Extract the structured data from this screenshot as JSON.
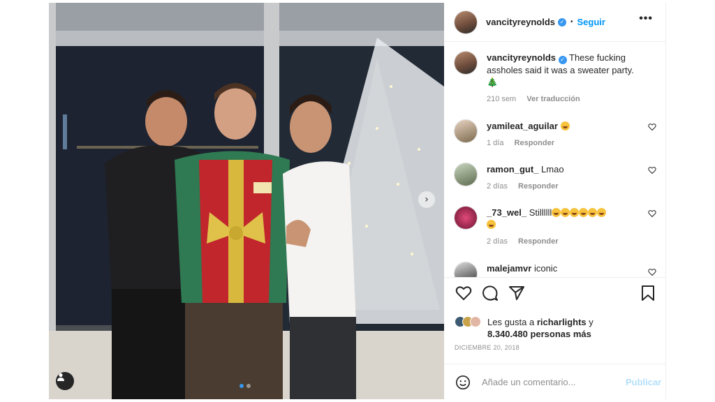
{
  "post": {
    "username": "vancityreynolds",
    "follow_label": "Seguir",
    "separator": "•",
    "more_label": "•••"
  },
  "caption": {
    "username": "vancityreynolds",
    "text": "These fucking assholes said it was a sweater party.",
    "emoji": "🎄",
    "age": "210 sem",
    "translate_label": "Ver traducción"
  },
  "comments": [
    {
      "username": "yamileat_aguilar",
      "text": "",
      "emoji_count": 1,
      "age": "1 día",
      "reply_label": "Responder"
    },
    {
      "username": "ramon_gut_",
      "text": "Lmao",
      "emoji_count": 0,
      "age": "2 días",
      "reply_label": "Responder"
    },
    {
      "username": "_73_wel_",
      "text": "Stillllll",
      "emoji_count": 7,
      "age": "2 días",
      "reply_label": "Responder"
    },
    {
      "username": "malejamvr",
      "text": "iconic",
      "emoji_count": 0,
      "age": "",
      "reply_label": ""
    }
  ],
  "likes": {
    "prefix": "Les gusta a",
    "user": "richarlights",
    "connector": "y",
    "count": "8.340.480 personas más"
  },
  "date": "DICIEMBRE 20, 2018",
  "add_comment": {
    "placeholder": "Añade un comentario...",
    "publish_label": "Publicar"
  },
  "carousel": {
    "total": 2,
    "current": 1
  },
  "icons": [
    "user-tag-icon",
    "chevron-right-icon",
    "verified-badge-icon",
    "more-options-icon",
    "heart-icon",
    "comment-icon",
    "share-icon",
    "bookmark-icon",
    "emoji-icon"
  ],
  "colors": {
    "accent": "#0095f6",
    "verified": "#3897f0",
    "publish_disabled": "#b2dffc",
    "muted": "#8e8e8e"
  }
}
